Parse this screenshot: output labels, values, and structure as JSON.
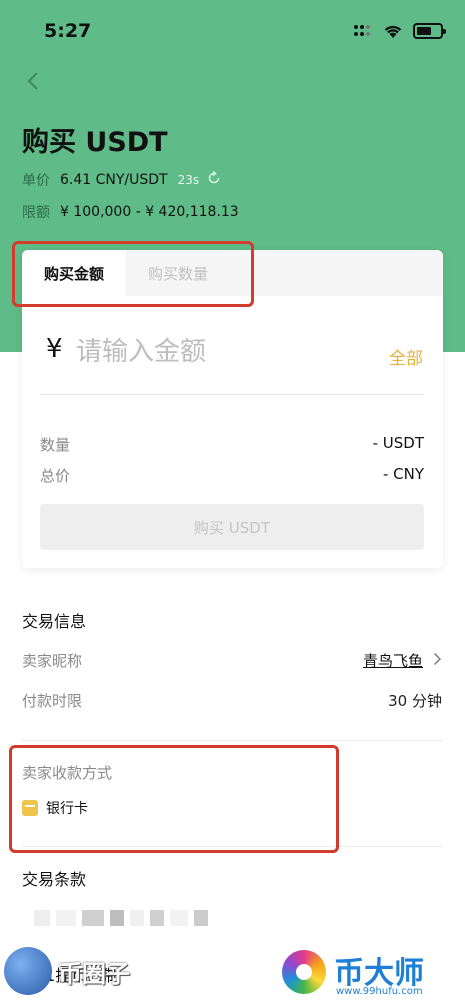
{
  "status_bar": {
    "time": "5:27"
  },
  "header": {
    "title": "购买 USDT",
    "price_label": "单价",
    "price_value": "6.41 CNY/USDT",
    "countdown": "23s",
    "limit_label": "限额",
    "limit_value": "¥ 100,000 - ¥ 420,118.13"
  },
  "tabs": [
    {
      "label": "购买金额",
      "active": true
    },
    {
      "label": "购买数量",
      "active": false
    }
  ],
  "amount": {
    "currency_symbol": "¥",
    "placeholder": "请输入金额",
    "all_label": "全部"
  },
  "summary": {
    "qty_label": "数量",
    "qty_value": "- USDT",
    "total_label": "总价",
    "total_value": "- CNY"
  },
  "buy_button": "购买 USDT",
  "trade_info": {
    "title": "交易信息",
    "seller_label": "卖家昵称",
    "seller_name": "青鸟飞鱼",
    "pay_limit_label": "付款时限",
    "pay_limit_value": "30 分钟"
  },
  "payment": {
    "title": "卖家收款方式",
    "method": "银行卡"
  },
  "terms": {
    "title": "交易条款",
    "first_line": "T+1提币限制"
  },
  "watermarks": {
    "left_text": "币圈子",
    "right_text": "币大师",
    "right_url": "www.99hufu.com"
  },
  "colors": {
    "header_green": "#5fbb87",
    "accent_gold": "#e2b23c",
    "annotation_red": "#d23b2d"
  },
  "icons": [
    "back-arrow-icon",
    "signal-icon",
    "wifi-icon",
    "battery-icon",
    "refresh-icon",
    "chevron-right-icon",
    "bank-card-icon"
  ]
}
